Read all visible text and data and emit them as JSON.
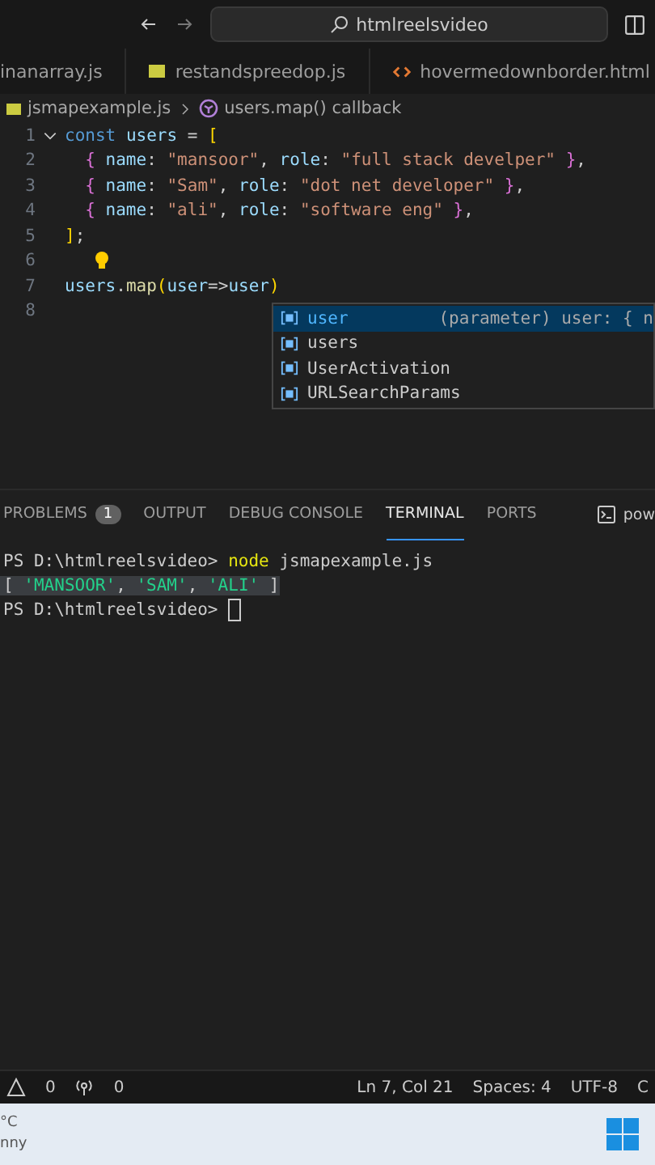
{
  "title_bar": {
    "search": "htmlreelsvideo"
  },
  "tabs": [
    {
      "label": "inanarray.js",
      "kind": "plain",
      "selected": false
    },
    {
      "label": "restandspreedop.js",
      "kind": "js",
      "selected": false
    },
    {
      "label": "hovermedownborder.html",
      "kind": "html",
      "selected": false
    }
  ],
  "breadcrumb": {
    "file": "jsmapexample.js",
    "symbol": "users.map() callback"
  },
  "editor": {
    "lines": [
      {
        "number": "1",
        "fold": true,
        "tokens": [
          {
            "kind": "kw",
            "text": "const "
          },
          {
            "kind": "var",
            "text": "users"
          },
          {
            "kind": "op",
            "text": " = "
          },
          {
            "kind": "br",
            "text": "["
          }
        ]
      },
      {
        "number": "2",
        "fold": false,
        "indent": true,
        "tokens": [
          {
            "kind": "br2",
            "text": "{"
          },
          {
            "kind": "prop",
            "text": " name"
          },
          {
            "kind": "op",
            "text": ": "
          },
          {
            "kind": "str",
            "text": "\"mansoor\""
          },
          {
            "kind": "op",
            "text": ", "
          },
          {
            "kind": "prop",
            "text": "role"
          },
          {
            "kind": "op",
            "text": ": "
          },
          {
            "kind": "str",
            "text": "\"full stack develper\""
          },
          {
            "kind": "br2",
            "text": " }"
          },
          {
            "kind": "op",
            "text": ","
          }
        ]
      },
      {
        "number": "3",
        "fold": false,
        "indent": true,
        "tokens": [
          {
            "kind": "br2",
            "text": "{"
          },
          {
            "kind": "prop",
            "text": " name"
          },
          {
            "kind": "op",
            "text": ": "
          },
          {
            "kind": "str",
            "text": "\"Sam\""
          },
          {
            "kind": "op",
            "text": ", "
          },
          {
            "kind": "prop",
            "text": "role"
          },
          {
            "kind": "op",
            "text": ": "
          },
          {
            "kind": "str",
            "text": "\"dot net developer\""
          },
          {
            "kind": "br2",
            "text": " }"
          },
          {
            "kind": "op",
            "text": ","
          }
        ]
      },
      {
        "number": "4",
        "fold": false,
        "indent": true,
        "tokens": [
          {
            "kind": "br2",
            "text": "{"
          },
          {
            "kind": "prop",
            "text": " name"
          },
          {
            "kind": "op",
            "text": ": "
          },
          {
            "kind": "str",
            "text": "\"ali\""
          },
          {
            "kind": "op",
            "text": ", "
          },
          {
            "kind": "prop",
            "text": "role"
          },
          {
            "kind": "op",
            "text": ": "
          },
          {
            "kind": "str",
            "text": "\"software eng\""
          },
          {
            "kind": "br2",
            "text": " }"
          },
          {
            "kind": "op",
            "text": ","
          }
        ]
      },
      {
        "number": "5",
        "fold": false,
        "tokens": [
          {
            "kind": "br",
            "text": "]"
          },
          {
            "kind": "op",
            "text": ";"
          }
        ]
      },
      {
        "number": "6",
        "fold": false,
        "bulb": true
      },
      {
        "number": "7",
        "fold": false,
        "tokens": [
          {
            "kind": "var",
            "text": "users"
          },
          {
            "kind": "op",
            "text": "."
          },
          {
            "kind": "fn",
            "text": "map"
          },
          {
            "kind": "br",
            "text": "("
          },
          {
            "kind": "param",
            "text": "user"
          },
          {
            "kind": "op",
            "text": "=>"
          },
          {
            "kind": "var",
            "text": "user"
          },
          {
            "kind": "br",
            "text": ")"
          }
        ]
      },
      {
        "number": "8",
        "fold": false
      }
    ]
  },
  "suggestions": [
    {
      "label": "user",
      "detail": "(parameter) user: { n",
      "selected": true
    },
    {
      "label": "users",
      "selected": false
    },
    {
      "label": "UserActivation",
      "selected": false
    },
    {
      "label": "URLSearchParams",
      "selected": false
    }
  ],
  "panel_tabs": [
    {
      "label": "PROBLEMS",
      "badge": "1",
      "selected": false
    },
    {
      "label": "OUTPUT",
      "selected": false
    },
    {
      "label": "DEBUG CONSOLE",
      "selected": false
    },
    {
      "label": "TERMINAL",
      "selected": true
    },
    {
      "label": "PORTS",
      "selected": false
    }
  ],
  "shell": "pow",
  "terminal": [
    {
      "kind": "plain",
      "tokens": [
        {
          "kind": "prompt",
          "text": "PS D:\\htmlreelsvideo> "
        },
        {
          "kind": "cmd",
          "text": "node"
        },
        {
          "kind": "prompt",
          "text": " jsmapexample.js"
        }
      ]
    },
    {
      "kind": "highlight",
      "tokens": [
        {
          "kind": "prompt",
          "text": "[ "
        },
        {
          "kind": "str",
          "text": "'MANSOOR'"
        },
        {
          "kind": "prompt",
          "text": ", "
        },
        {
          "kind": "str",
          "text": "'SAM'"
        },
        {
          "kind": "prompt",
          "text": ", "
        },
        {
          "kind": "str",
          "text": "'ALI'"
        },
        {
          "kind": "prompt",
          "text": " ]"
        }
      ]
    },
    {
      "kind": "cursor",
      "tokens": [
        {
          "kind": "prompt",
          "text": "PS D:\\htmlreelsvideo> "
        }
      ]
    }
  ],
  "status_bar": {
    "warnings": "0",
    "ports": "0",
    "position": "Ln 7, Col 21",
    "spaces": "Spaces: 4",
    "encoding": "UTF-8",
    "cut": "C"
  },
  "taskbar": {
    "weather_temp": "°C",
    "weather_text": "nny"
  }
}
